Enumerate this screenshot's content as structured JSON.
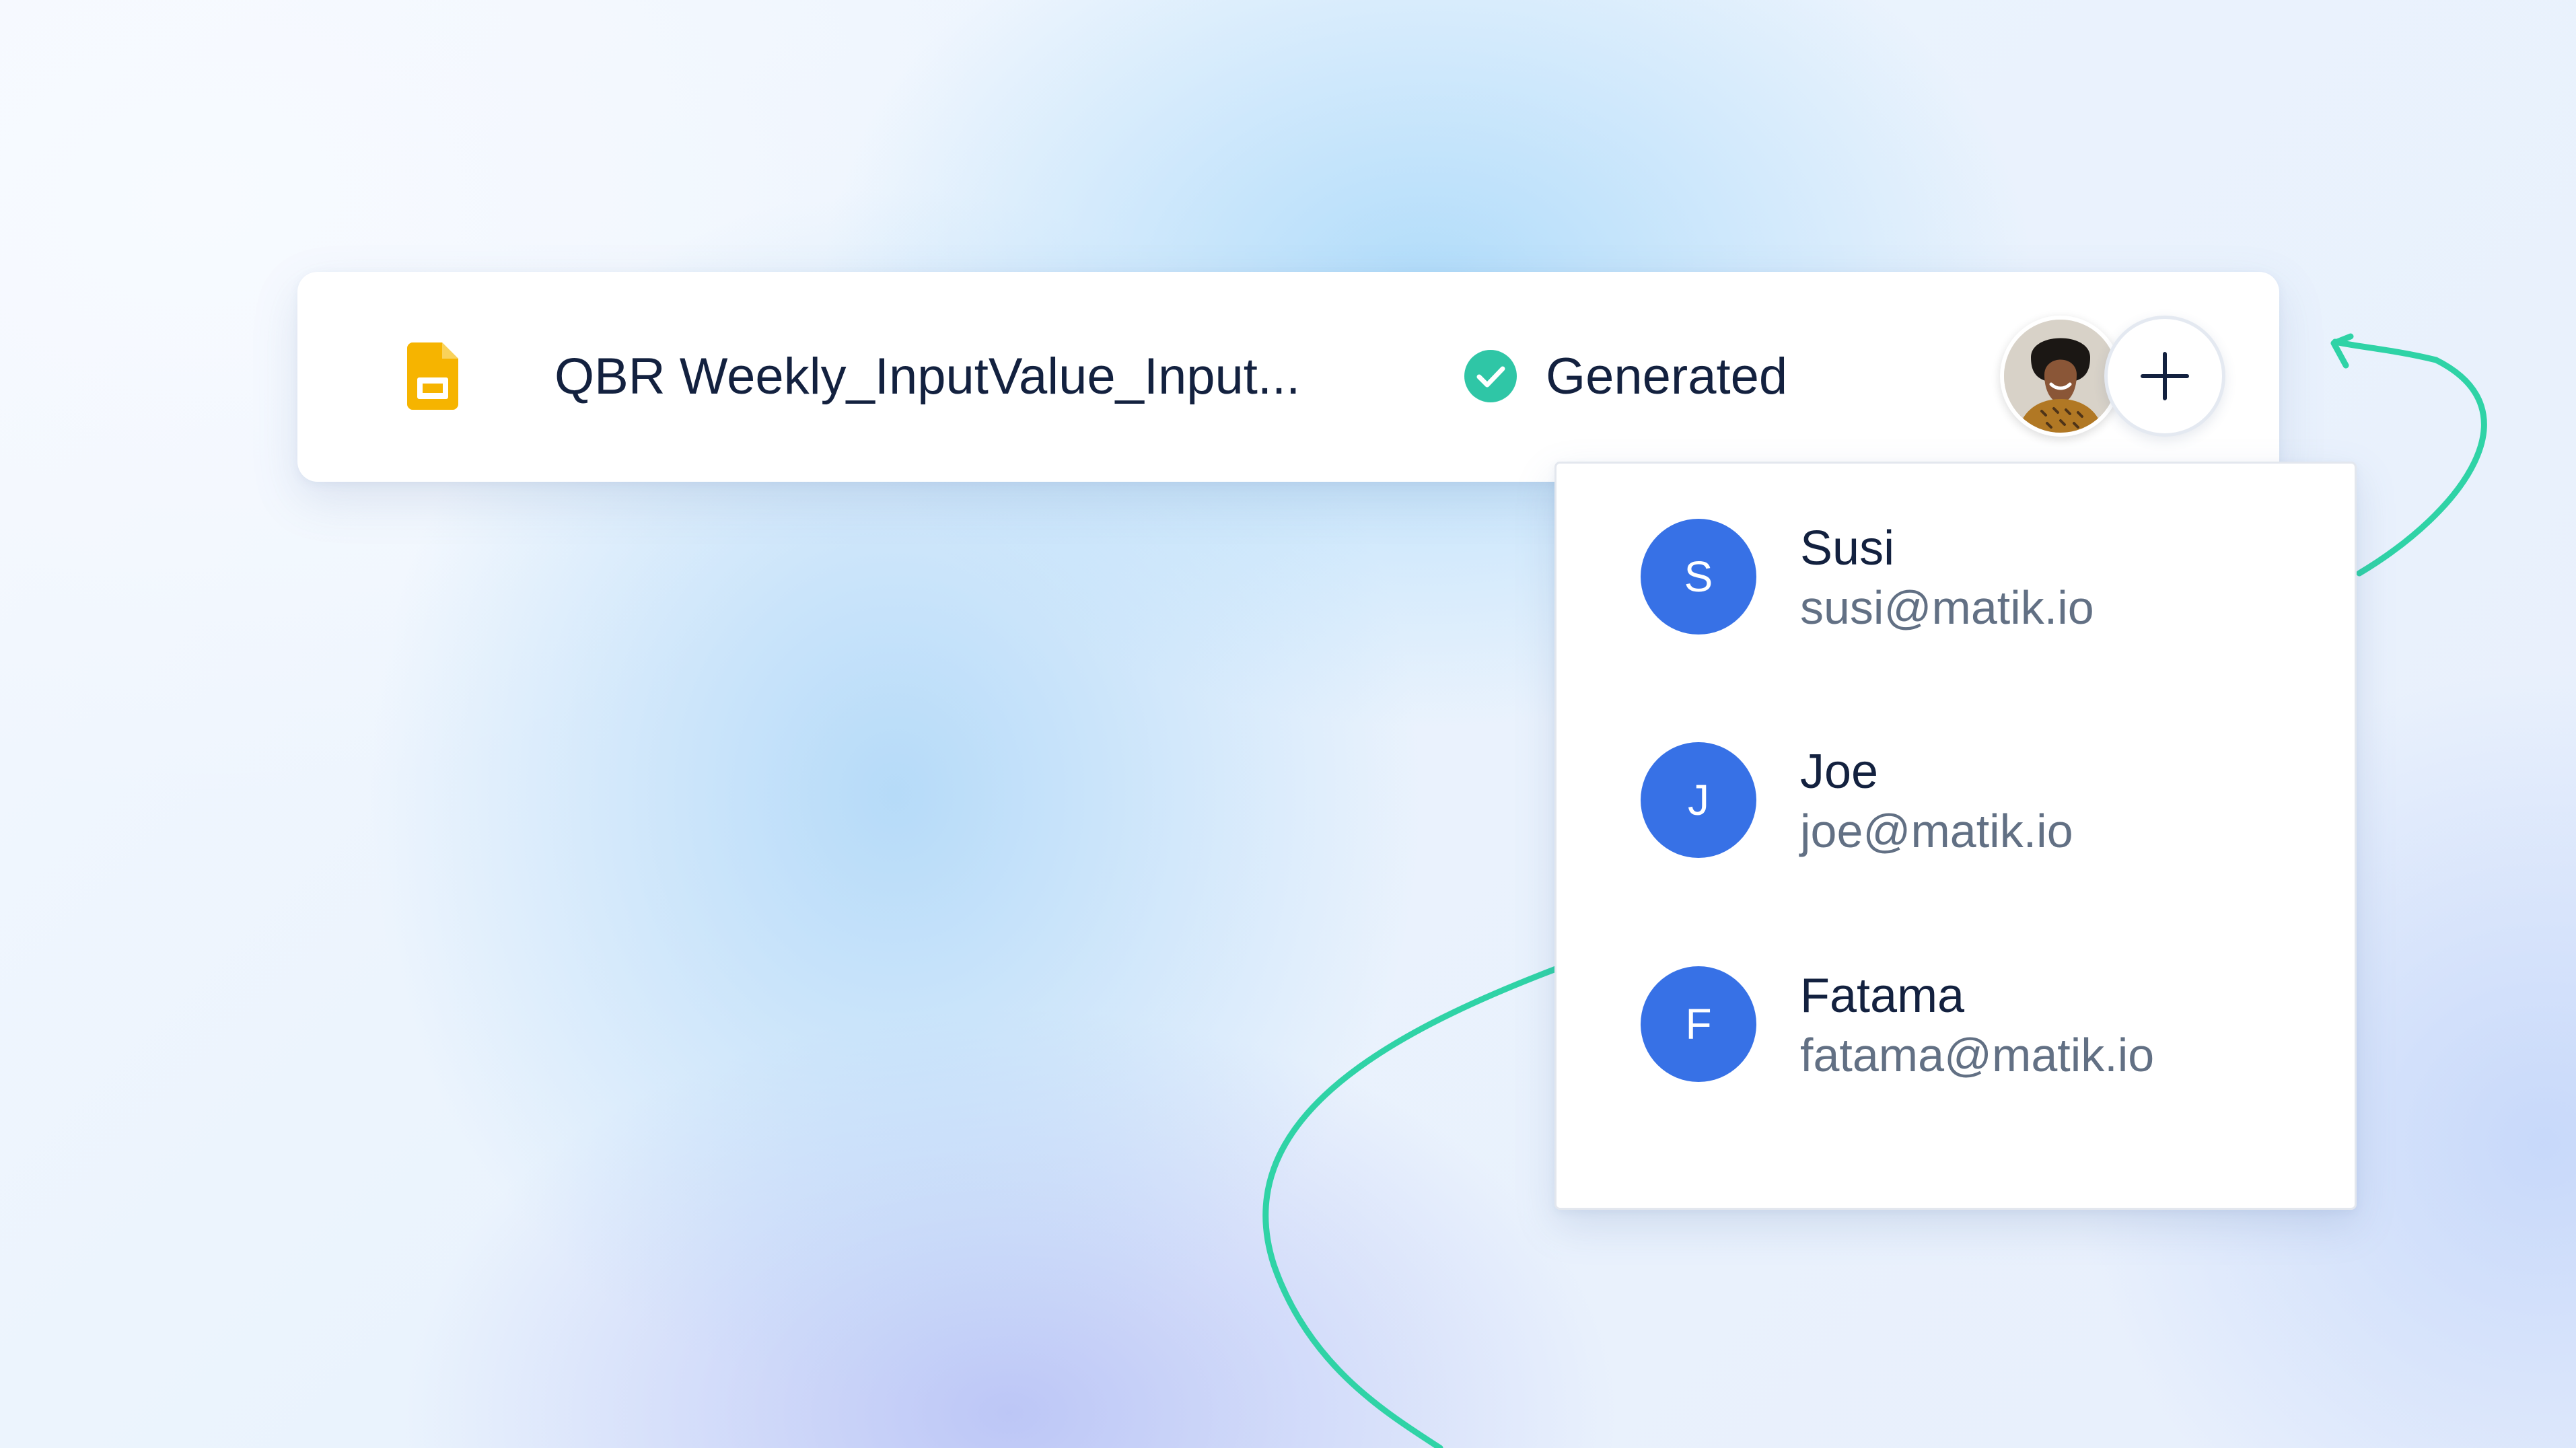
{
  "document": {
    "icon": "google-slides-icon",
    "title": "QBR Weekly_InputValue_Input...",
    "status": {
      "icon": "check-circle-icon",
      "label": "Generated",
      "color": "#2fc6a6"
    },
    "owner_avatar": "user-avatar",
    "add_icon": "plus-icon"
  },
  "share_menu": {
    "items": [
      {
        "initial": "S",
        "name": "Susi",
        "email": "susi@matik.io"
      },
      {
        "initial": "J",
        "name": "Joe",
        "email": "joe@matik.io"
      },
      {
        "initial": "F",
        "name": "Fatama",
        "email": "fatama@matik.io"
      }
    ]
  },
  "colors": {
    "accent": "#3771e6",
    "curve": "#2fd3a6",
    "slides_icon": "#f6b400",
    "text_primary": "#13213f",
    "text_secondary": "#627084"
  }
}
